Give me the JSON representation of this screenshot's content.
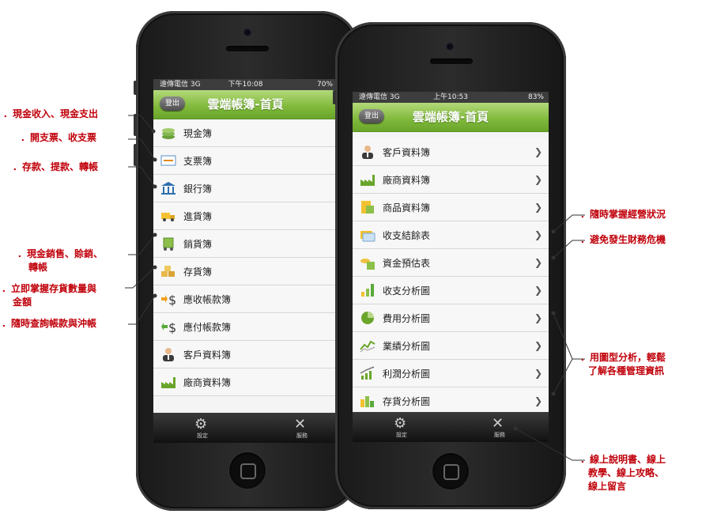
{
  "left_phone": {
    "status": {
      "carrier": "遠傳電信 3G",
      "time": "下午10:08",
      "battery": "70%"
    },
    "back_label": "登出",
    "title": "雲端帳簿-首頁",
    "items": [
      {
        "label": "現金簿",
        "icon": "coins-icon"
      },
      {
        "label": "支票簿",
        "icon": "cheque-icon"
      },
      {
        "label": "銀行簿",
        "icon": "bank-icon"
      },
      {
        "label": "進貨簿",
        "icon": "truck-icon"
      },
      {
        "label": "銷貨簿",
        "icon": "cart-icon"
      },
      {
        "label": "存貨簿",
        "icon": "boxes-icon"
      },
      {
        "label": "應收帳款簿",
        "icon": "receivable-icon"
      },
      {
        "label": "應付帳款簿",
        "icon": "payable-icon"
      },
      {
        "label": "客戶資料簿",
        "icon": "customer-icon"
      },
      {
        "label": "廠商資料簿",
        "icon": "factory-icon"
      }
    ],
    "tabs": [
      {
        "label": "設定",
        "icon": "gear-icon"
      },
      {
        "label": "服務",
        "icon": "tools-icon"
      }
    ]
  },
  "right_phone": {
    "status": {
      "carrier": "遠傳電信 3G",
      "time": "上午10:53",
      "battery": "83%"
    },
    "back_label": "登出",
    "title": "雲端帳簿-首頁",
    "items": [
      {
        "label": "客戶資料簿",
        "icon": "customer-icon"
      },
      {
        "label": "廠商資料簿",
        "icon": "factory-icon"
      },
      {
        "label": "商品資料簿",
        "icon": "product-icon"
      },
      {
        "label": "收支結餘表",
        "icon": "card-icon"
      },
      {
        "label": "資金預估表",
        "icon": "forecast-icon"
      },
      {
        "label": "收支分析圖",
        "icon": "bar-chart-icon"
      },
      {
        "label": "費用分析圖",
        "icon": "pie-chart-icon"
      },
      {
        "label": "業績分析圖",
        "icon": "line-chart-icon"
      },
      {
        "label": "利潤分析圖",
        "icon": "profit-chart-icon"
      },
      {
        "label": "存貨分析圖",
        "icon": "inventory-chart-icon"
      }
    ],
    "tabs": [
      {
        "label": "設定",
        "icon": "gear-icon"
      },
      {
        "label": "服務",
        "icon": "tools-icon"
      }
    ]
  },
  "annotations": {
    "a1": "．現金收入、現金支出",
    "a2": "．開支票、收支票",
    "a3": "．存款、提款、轉帳",
    "a4_line1": "．現金銷售、賒銷、",
    "a4_line2": "轉帳",
    "a5_line1": "．立即掌握存貨數量與",
    "a5_line2": "金額",
    "a6": "．隨時查詢帳款與沖帳",
    "b1": "．隨時掌握經營狀況",
    "b2": "．避免發生財務危機",
    "b3_line1": "．用圖型分析，輕鬆",
    "b3_line2": "了解各種管理資訊",
    "b4_line1": "．線上說明書、線上",
    "b4_line2": "教學、線上攻略、",
    "b4_line3": "線上留言"
  },
  "colors": {
    "accent_green": "#7fb83a",
    "annotation_red": "#c0000a"
  }
}
